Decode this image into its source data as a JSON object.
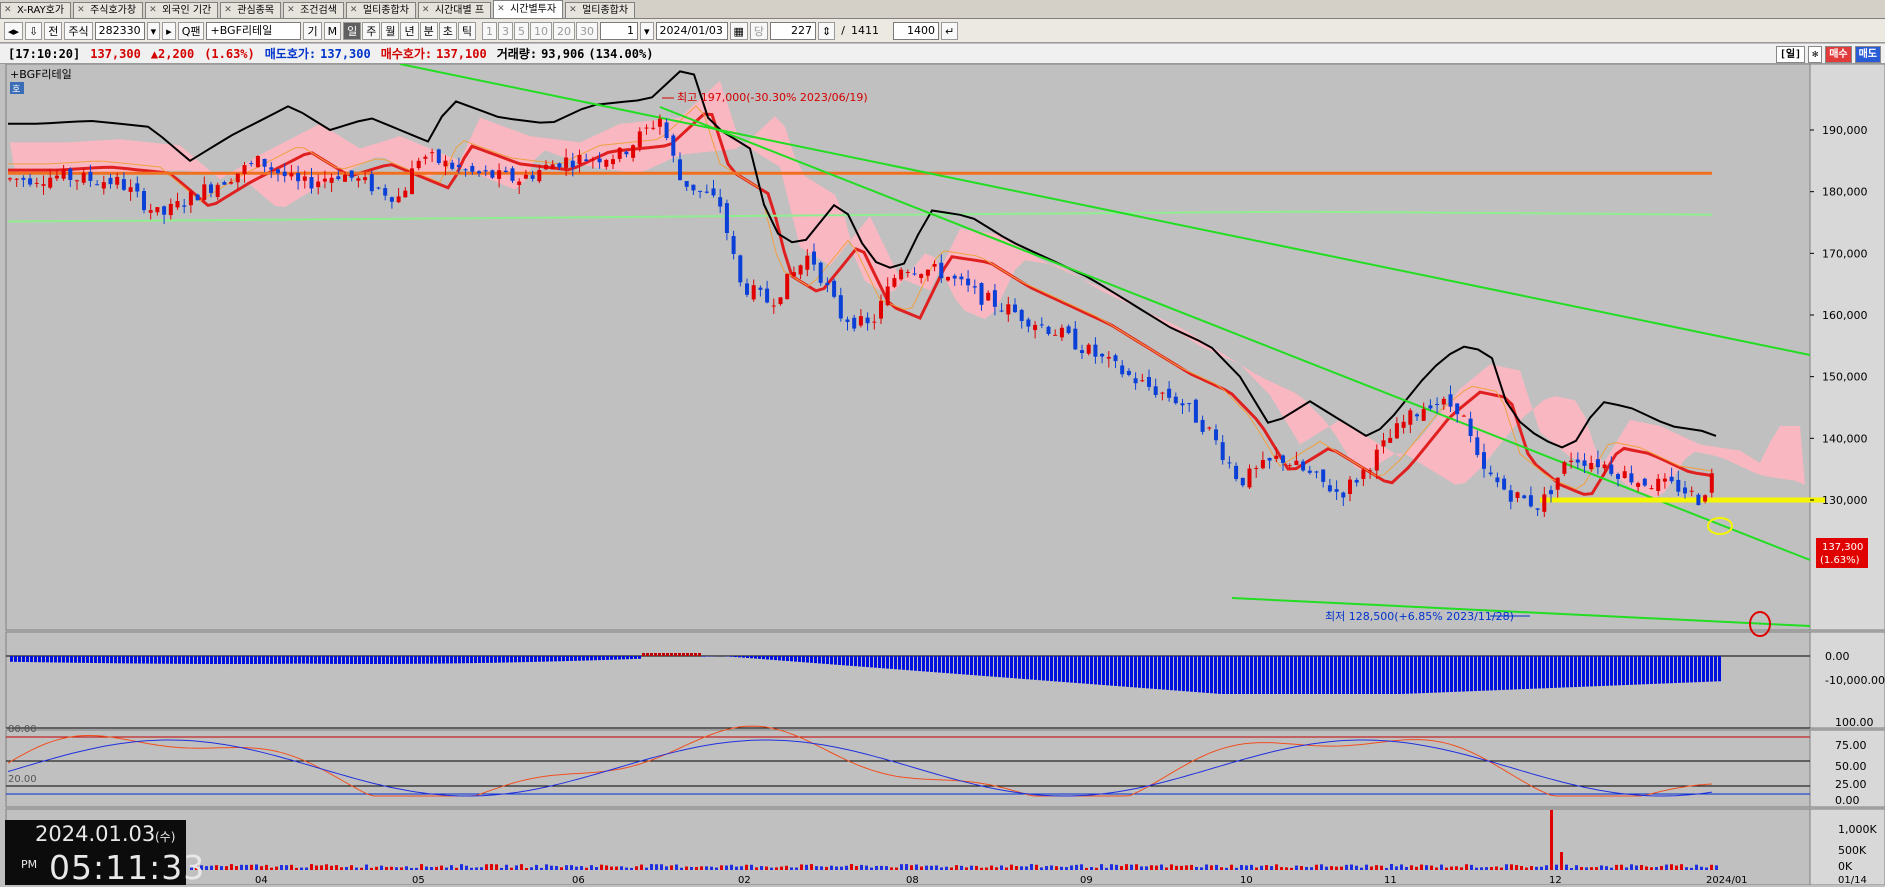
{
  "tabs": [
    {
      "label": "X-RAY호가",
      "active": false
    },
    {
      "label": "주식호가창",
      "active": false
    },
    {
      "label": "외국인 기간",
      "active": false
    },
    {
      "label": "관심종목",
      "active": false
    },
    {
      "label": "조건검색",
      "active": false
    },
    {
      "label": "멀티종합차",
      "active": false
    },
    {
      "label": "시간대별 프",
      "active": false
    },
    {
      "label": "시간별투자",
      "active": true
    },
    {
      "label": "멀티종합차",
      "active": false
    }
  ],
  "toolbar": {
    "btn_jeon": "전",
    "market": "주식",
    "code": "282330",
    "search_label": "Q팬",
    "stock_name": "+BGF리테일",
    "btn_gi": "기",
    "btn_m": "M",
    "periods": [
      "일",
      "주",
      "월",
      "년",
      "분",
      "초",
      "틱"
    ],
    "minutes": [
      "1",
      "3",
      "5",
      "10",
      "20",
      "30"
    ],
    "interval": "1",
    "date": "2024/01/03",
    "dang": "당",
    "count": "227",
    "slash": "/",
    "total": "1411",
    "view": "1400"
  },
  "quote": {
    "time": "[17:10:20]",
    "price": "137,300",
    "change": "▲2,200",
    "pct": "(1.63%)",
    "ask_label": "매도호가:",
    "ask": "137,300",
    "bid_label": "매수호가:",
    "bid": "137,100",
    "vol_label": "거래량:",
    "vol": "93,906",
    "vol_pct": "(134.00%)",
    "btn_day": "[일]",
    "btn_buy": "매수",
    "btn_sell": "매도"
  },
  "panel": {
    "name": "+BGF리테일",
    "badge": "호"
  },
  "annotations": {
    "high": "최고 197,000(-30.30% 2023/06/19)",
    "low": "최저 128,500(+6.85% 2023/11/28)"
  },
  "price_tag": {
    "price": "137,300",
    "pct": "(1.63%)"
  },
  "clock": {
    "date": "2024.01.03",
    "dow": "(수)",
    "ampm": "PM",
    "time": "05:11:33"
  },
  "chart_data": {
    "type": "candlestick",
    "price_axis": {
      "ticks": [
        "190,000",
        "180,000",
        "170,000",
        "160,000",
        "150,000",
        "140,000",
        "130,000"
      ]
    },
    "macd_axis": {
      "ticks": [
        "0.00",
        "-10,000.00"
      ]
    },
    "stoch_axis": {
      "ticks": [
        "100.00",
        "75.00",
        "50.00",
        "25.00",
        "0.00"
      ],
      "labels": [
        "80.00",
        "20.00"
      ]
    },
    "volume_axis": {
      "ticks": [
        "1,000K",
        "500K",
        "0K"
      ]
    },
    "x_labels": [
      "04",
      "05",
      "06",
      "02",
      "08",
      "09",
      "10",
      "11",
      "12",
      "2024/01",
      "01/14"
    ],
    "colors": {
      "up": "#e00000",
      "down": "#0a3fd8",
      "trend": "#22dd22",
      "ma_red": "#e02020",
      "ma_orange": "#f07020",
      "cloud": "#ffb6c1",
      "highlight": "#f5f500"
    }
  }
}
